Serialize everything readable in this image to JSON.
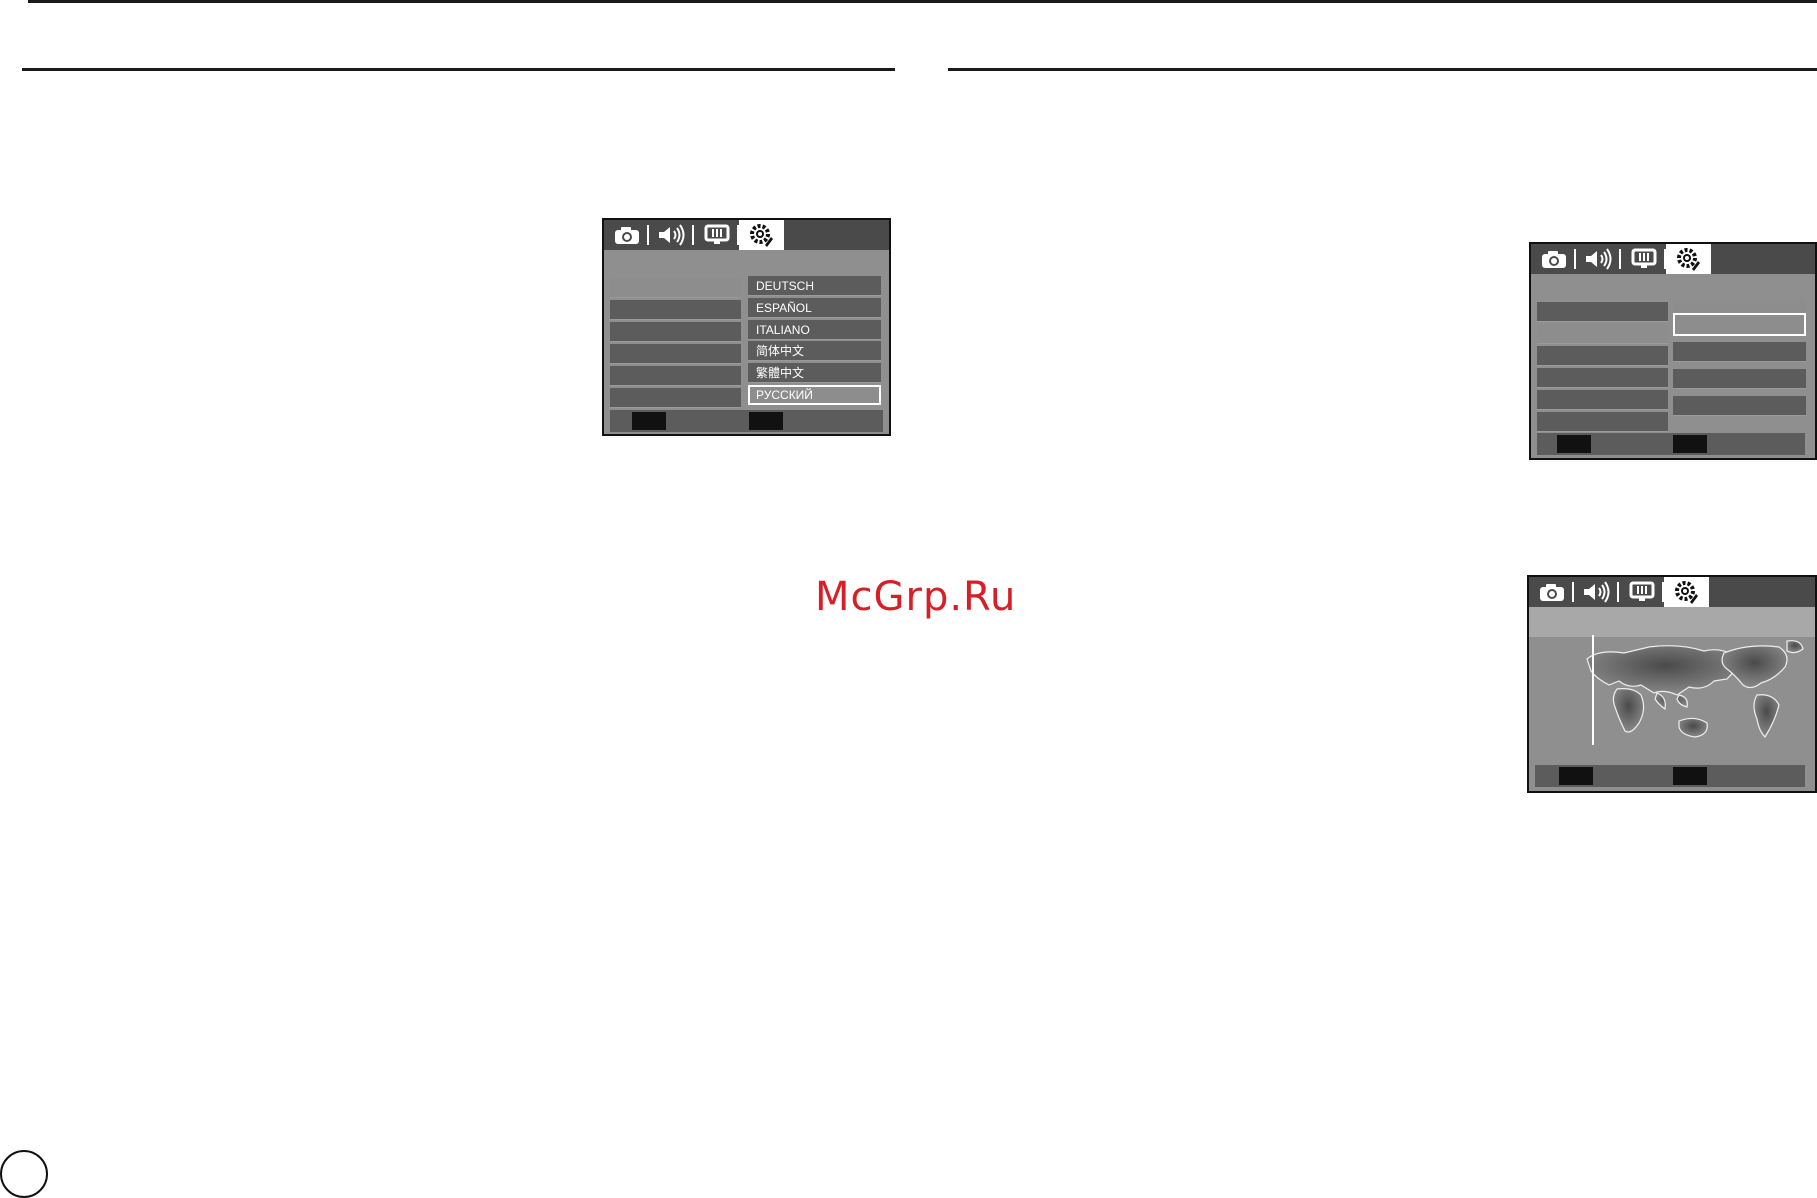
{
  "watermark": "McGrp.Ru",
  "icons": [
    "camera-icon",
    "speaker-icon",
    "display-icon",
    "gear-icon"
  ],
  "colors": {
    "screen_bg": "#8f8f8f",
    "tab_bar": "#4a4a4a",
    "menu_item": "#5c5c5c",
    "highlight": "#ffffff",
    "watermark": "#d61f26"
  },
  "language_screen": {
    "languages": [
      "DEUTSCH",
      "ESPAÑOL",
      "ITALIANO",
      "简体中文",
      "繁體中文",
      "РУССКИЙ"
    ],
    "selected_language": "РУССКИЙ"
  }
}
